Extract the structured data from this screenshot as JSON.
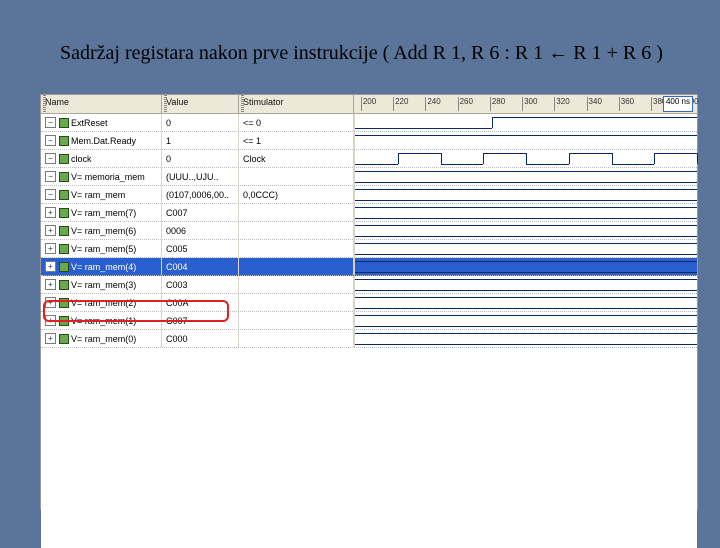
{
  "title": "Sadržaj registara nakon prve instrukcije ( Add R 1, R 6 :  R 1 ←  R 1 + R 6  )",
  "headers": {
    "name": "Name",
    "value": "Value",
    "stim": "Stimulator"
  },
  "ticks": [
    "200",
    "220",
    "240",
    "260",
    "280",
    "300",
    "320",
    "340",
    "360",
    "380",
    "400"
  ],
  "marker": "400 ns",
  "rows": [
    {
      "name": "ExtReset",
      "value": "0",
      "stim": "<= 0",
      "icon": "col",
      "wave": "reset"
    },
    {
      "name": "Mem.Dat.Ready",
      "value": "1",
      "stim": "<= 1",
      "icon": "col",
      "wave": "high"
    },
    {
      "name": "clock",
      "value": "0",
      "stim": "Clock",
      "icon": "col",
      "wave": "clock"
    },
    {
      "name": "V= memoria_mem",
      "value": "(UUU..,UJU..",
      "stim": "",
      "icon": "col",
      "wave": "bus"
    },
    {
      "name": "V= ram_mem",
      "value": "(0107,0006,00..",
      "stim": "0,0CCC)",
      "icon": "col",
      "wave": "bus"
    },
    {
      "name": "V= ram_mem(7)",
      "value": "C007",
      "stim": "",
      "icon": "exp",
      "wave": "line"
    },
    {
      "name": "V= ram_mem(6)",
      "value": "0006",
      "stim": "",
      "icon": "exp",
      "wave": "line"
    },
    {
      "name": "V= ram_mem(5)",
      "value": "C005",
      "stim": "",
      "icon": "exp",
      "wave": "line"
    },
    {
      "name": "V= ram_mem(4)",
      "value": "C004",
      "stim": "",
      "icon": "exp",
      "wave": "line",
      "selected": true
    },
    {
      "name": "V= ram_mem(3)",
      "value": "C003",
      "stim": "",
      "icon": "exp",
      "wave": "line"
    },
    {
      "name": "V= ram_mem(2)",
      "value": "C00A",
      "stim": "",
      "icon": "exp",
      "wave": "line"
    },
    {
      "name": "V= ram_mem(1)",
      "value": "C007",
      "stim": "",
      "icon": "exp",
      "wave": "line",
      "highlight": true
    },
    {
      "name": "V= ram_mem(0)",
      "value": "C000",
      "stim": "",
      "icon": "exp",
      "wave": "line"
    }
  ]
}
